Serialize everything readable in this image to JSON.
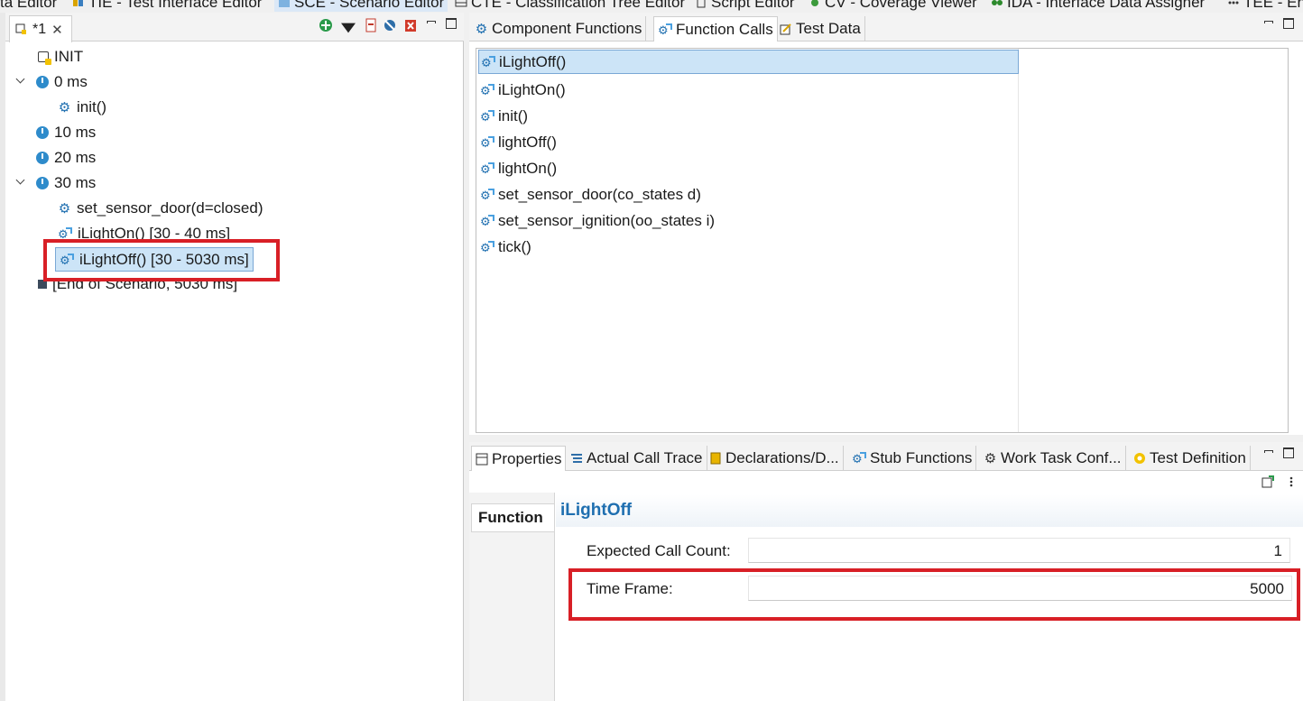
{
  "perspectives": [
    {
      "label": "ta Editor",
      "icon": "none"
    },
    {
      "label": "TIE - Test Interface Editor",
      "icon": "tie-icon"
    },
    {
      "label": "SCE - Scenario Editor",
      "icon": "sce-icon"
    },
    {
      "label": "CTE - Classification Tree Editor",
      "icon": "cte-icon"
    },
    {
      "label": "Script Editor",
      "icon": "script-icon"
    },
    {
      "label": "CV - Coverage Viewer",
      "icon": "cv-icon"
    },
    {
      "label": "IDA - Interface Data Assigner",
      "icon": "ida-icon"
    },
    {
      "label": "TEE - En",
      "icon": "tee-icon"
    }
  ],
  "editor": {
    "tab_label": "*1",
    "tree": [
      {
        "label": "INIT",
        "icon": "init-icon"
      },
      {
        "label": "0 ms",
        "icon": "clock-icon"
      },
      {
        "label": "init()",
        "icon": "gear-icon"
      },
      {
        "label": "10 ms",
        "icon": "clock-icon"
      },
      {
        "label": "20 ms",
        "icon": "clock-icon"
      },
      {
        "label": "30 ms",
        "icon": "clock-icon"
      },
      {
        "label": "set_sensor_door(d=closed)",
        "icon": "gear-icon"
      },
      {
        "label": "iLightOn() [30 - 40 ms]",
        "icon": "function-call-icon"
      },
      {
        "label": "iLightOff() [30 - 5030 ms]",
        "icon": "function-call-icon"
      },
      {
        "label": "[End of Scenario, 5030 ms]",
        "icon": "end-icon"
      }
    ]
  },
  "top_views": {
    "tabs": [
      "Component Functions",
      "Function Calls",
      "Test Data"
    ],
    "functions": [
      "iLightOff()",
      "iLightOn()",
      "init()",
      "lightOff()",
      "lightOn()",
      "set_sensor_door(co_states d)",
      "set_sensor_ignition(oo_states i)",
      "tick()"
    ]
  },
  "bottom_views": {
    "tabs": [
      "Properties",
      "Actual Call Trace",
      "Declarations/D...",
      "Stub Functions",
      "Work Task Conf...",
      "Test Definition"
    ],
    "side_tab": "Function",
    "title": "iLightOff",
    "expected_call_count_label": "Expected Call Count:",
    "expected_call_count_value": "1",
    "time_frame_label": "Time Frame:",
    "time_frame_value": "5000"
  },
  "colors": {
    "highlight_red": "#d81f26",
    "accent_blue": "#1f6fb0",
    "selection": "#cce4f7"
  }
}
